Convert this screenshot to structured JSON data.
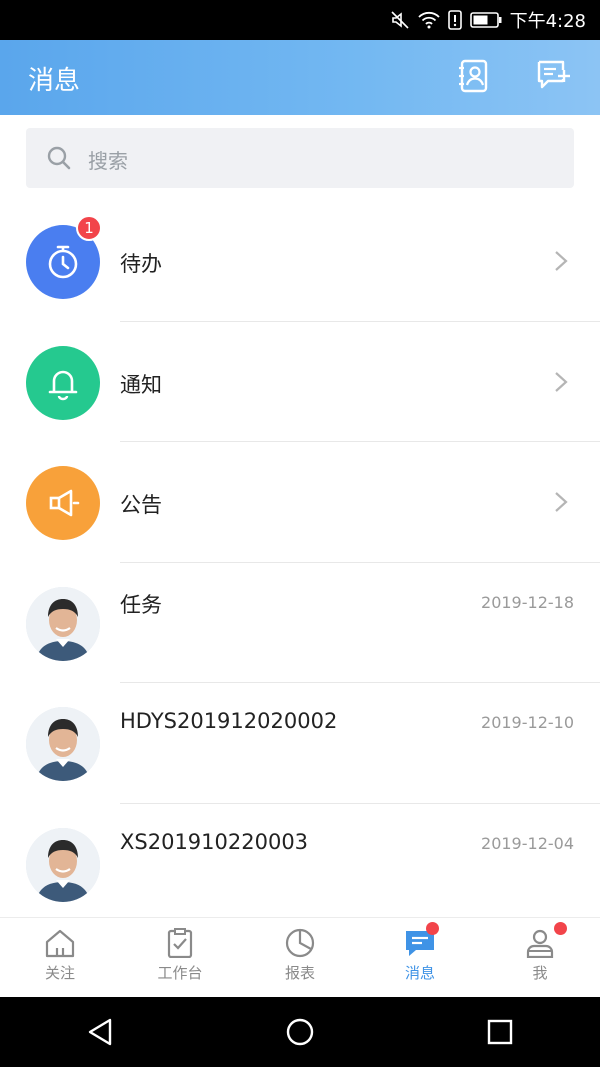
{
  "status_bar": {
    "time": "下午4:28",
    "icons": [
      "mute-icon",
      "wifi-icon",
      "sim-alert-icon",
      "battery-icon"
    ]
  },
  "header": {
    "title": "消息",
    "actions": [
      "contacts-icon",
      "new-message-icon"
    ]
  },
  "search": {
    "placeholder": "搜索"
  },
  "messages": [
    {
      "name": "待办",
      "icon": "timer-icon",
      "color": "#4a7ef0",
      "badge": "1",
      "has_chevron": true
    },
    {
      "name": "通知",
      "icon": "bell-icon",
      "color": "#25c98f",
      "has_chevron": true
    },
    {
      "name": "公告",
      "icon": "megaphone-icon",
      "color": "#f8a13a",
      "has_chevron": true
    },
    {
      "name": "任务",
      "icon": "avatar",
      "date": "2019-12-18"
    },
    {
      "name": "HDYS201912020002",
      "icon": "avatar",
      "date": "2019-12-10"
    },
    {
      "name": "XS201910220003",
      "icon": "avatar",
      "date": "2019-12-04"
    }
  ],
  "tabs": [
    {
      "label": "关注",
      "icon": "home-icon"
    },
    {
      "label": "工作台",
      "icon": "clipboard-icon"
    },
    {
      "label": "报表",
      "icon": "pie-chart-icon"
    },
    {
      "label": "消息",
      "icon": "message-icon",
      "active": true,
      "dot": true
    },
    {
      "label": "我",
      "icon": "person-icon",
      "dot": true
    }
  ],
  "colors": {
    "accent": "#3f93e6",
    "badge": "#f2444a",
    "header_start": "#5aa6ec",
    "header_end": "#8cc4f4"
  }
}
